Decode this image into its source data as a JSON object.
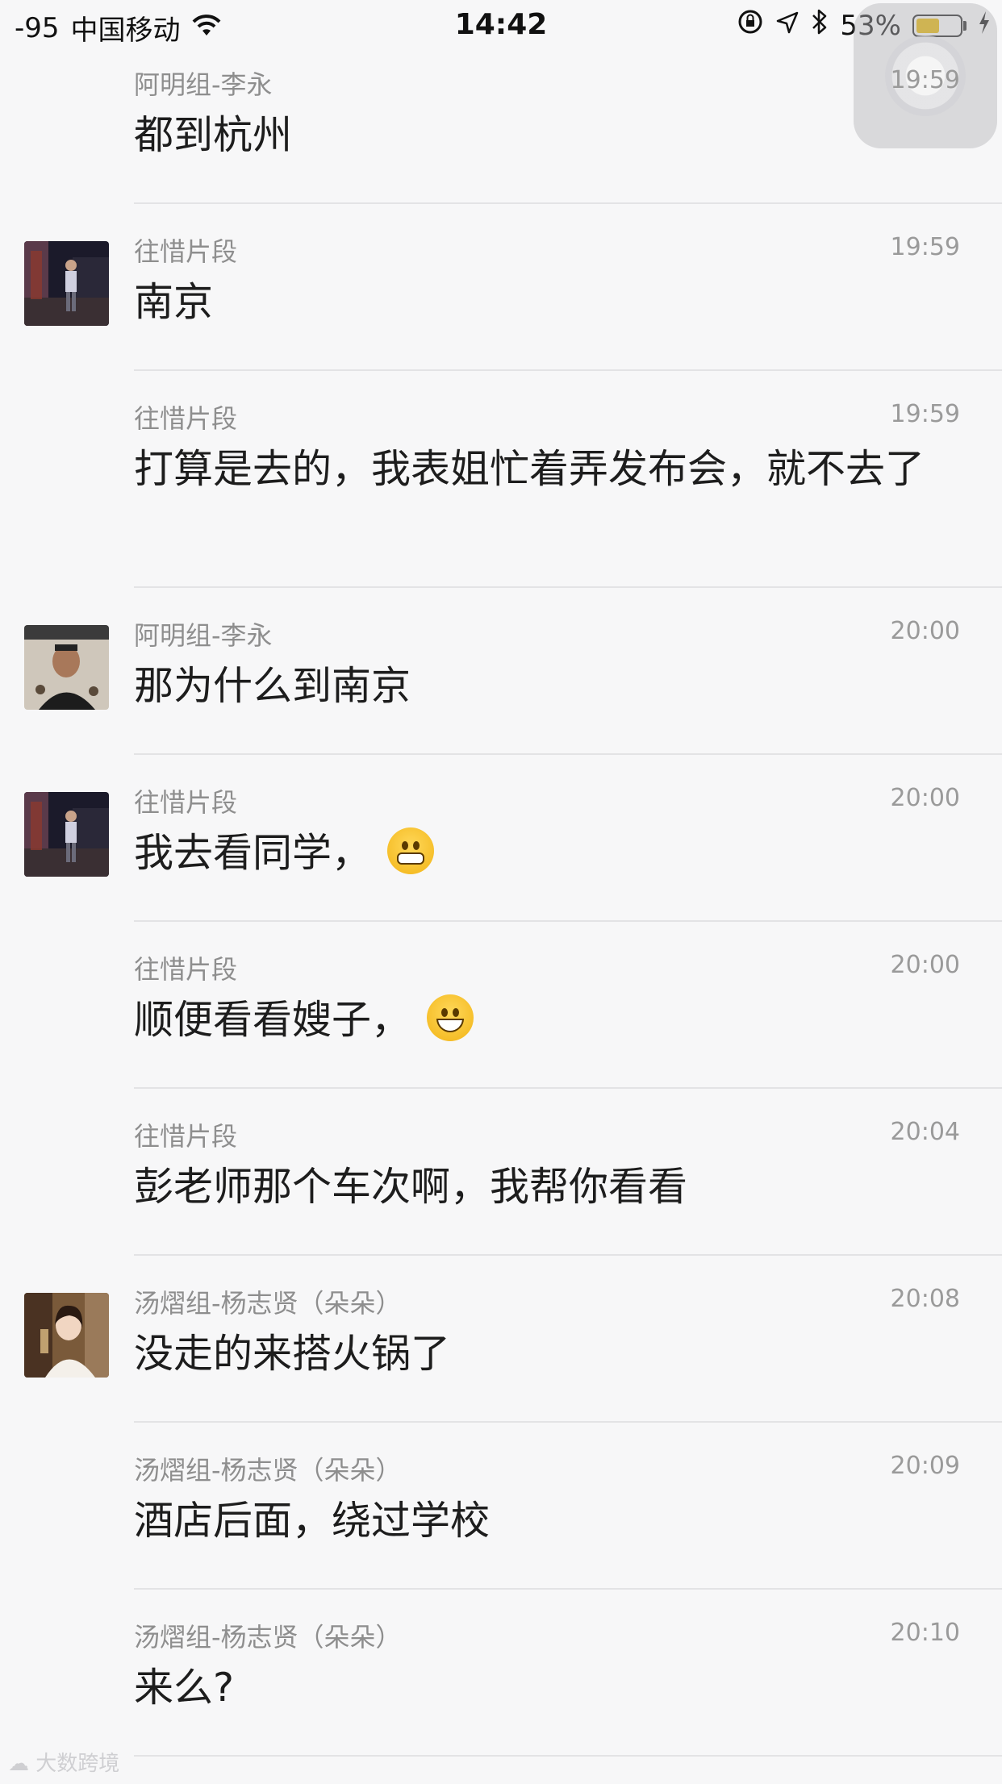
{
  "status_bar": {
    "signal": "-95",
    "carrier": "中国移动",
    "time": "14:42",
    "battery": "53%",
    "battery_level": 0.53
  },
  "messages": [
    {
      "sender": "阿明组-李永",
      "time": "19:59",
      "text": "都到杭州",
      "avatar": null
    },
    {
      "sender": "往惜片段",
      "time": "19:59",
      "text": "南京",
      "avatar": "stage-photo"
    },
    {
      "sender": "往惜片段",
      "time": "19:59",
      "text": "打算是去的，我表姐忙着弄发布会，就不去了",
      "avatar": null
    },
    {
      "sender": "阿明组-李永",
      "time": "20:00",
      "text": "那为什么到南京",
      "avatar": "man-photo"
    },
    {
      "sender": "往惜片段",
      "time": "20:00",
      "text": "我去看同学，",
      "emoji": "grinning-face-icon",
      "avatar": "stage-photo"
    },
    {
      "sender": "往惜片段",
      "time": "20:00",
      "text": "顺便看看嫂子，",
      "emoji": "smiling-face-icon",
      "avatar": null
    },
    {
      "sender": "往惜片段",
      "time": "20:04",
      "text": "彭老师那个车次啊，我帮你看看",
      "avatar": null
    },
    {
      "sender": "汤熠组-杨志贤（朵朵）",
      "time": "20:08",
      "text": "没走的来搭火锅了",
      "avatar": "woman-photo"
    },
    {
      "sender": "汤熠组-杨志贤（朵朵）",
      "time": "20:09",
      "text": "酒店后面，绕过学校",
      "avatar": null
    },
    {
      "sender": "汤熠组-杨志贤（朵朵）",
      "time": "20:10",
      "text": "来么?",
      "avatar": null
    }
  ],
  "watermark": "大数跨境"
}
